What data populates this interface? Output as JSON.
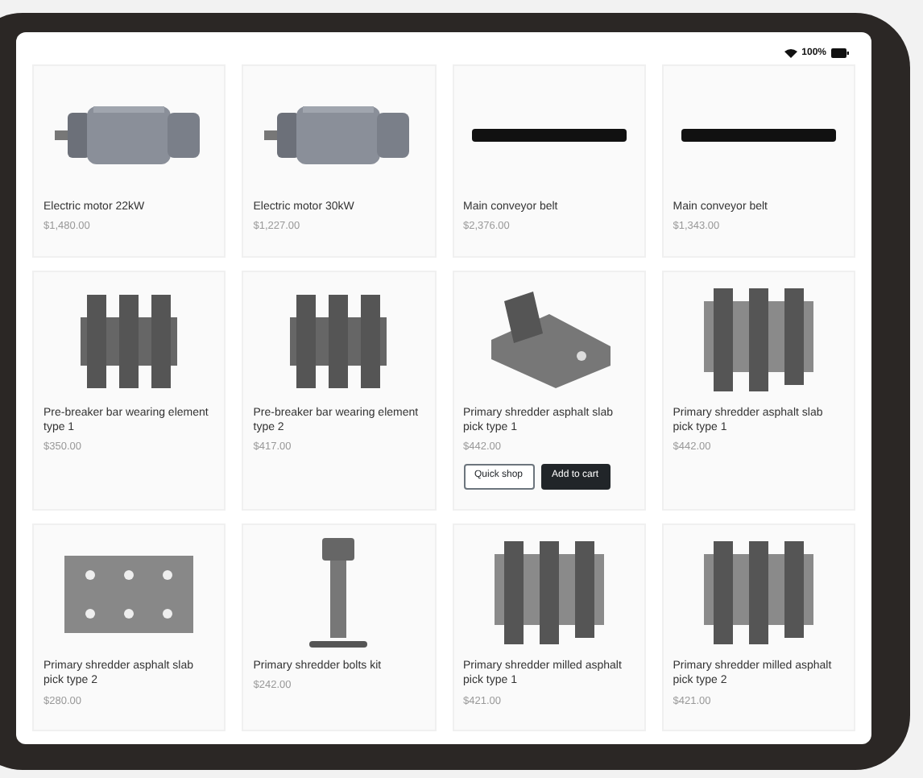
{
  "status_bar": {
    "battery_text": "100%"
  },
  "products": [
    {
      "name": "Electric motor 22kW",
      "price": "$1,480.00",
      "kind": "motor"
    },
    {
      "name": "Electric motor 30kW",
      "price": "$1,227.00",
      "kind": "motor"
    },
    {
      "name": "Main conveyor belt",
      "price": "$2,376.00",
      "kind": "belt"
    },
    {
      "name": "Main conveyor belt",
      "price": "$1,343.00",
      "kind": "belt"
    },
    {
      "name": "Pre-breaker bar wearing element type 1",
      "price": "$350.00",
      "kind": "bar"
    },
    {
      "name": "Pre-breaker bar wearing element type 2",
      "price": "$417.00",
      "kind": "bar"
    },
    {
      "name": "Primary shredder asphalt slab pick type 1",
      "price": "$442.00",
      "kind": "pick",
      "actions": [
        "Quick shop",
        "Add to cart"
      ]
    },
    {
      "name": "Primary shredder asphalt slab pick type 1",
      "price": "$442.00",
      "kind": "plate"
    },
    {
      "name": "Primary shredder asphalt slab pick type 2",
      "price": "$280.00",
      "kind": "slab"
    },
    {
      "name": "Primary shredder bolts kit",
      "price": "$242.00",
      "kind": "bolt"
    },
    {
      "name": "Primary shredder milled asphalt pick type 1",
      "price": "$421.00",
      "kind": "plate"
    },
    {
      "name": "Primary shredder milled asphalt pick type 2",
      "price": "$421.00",
      "kind": "plate"
    }
  ]
}
